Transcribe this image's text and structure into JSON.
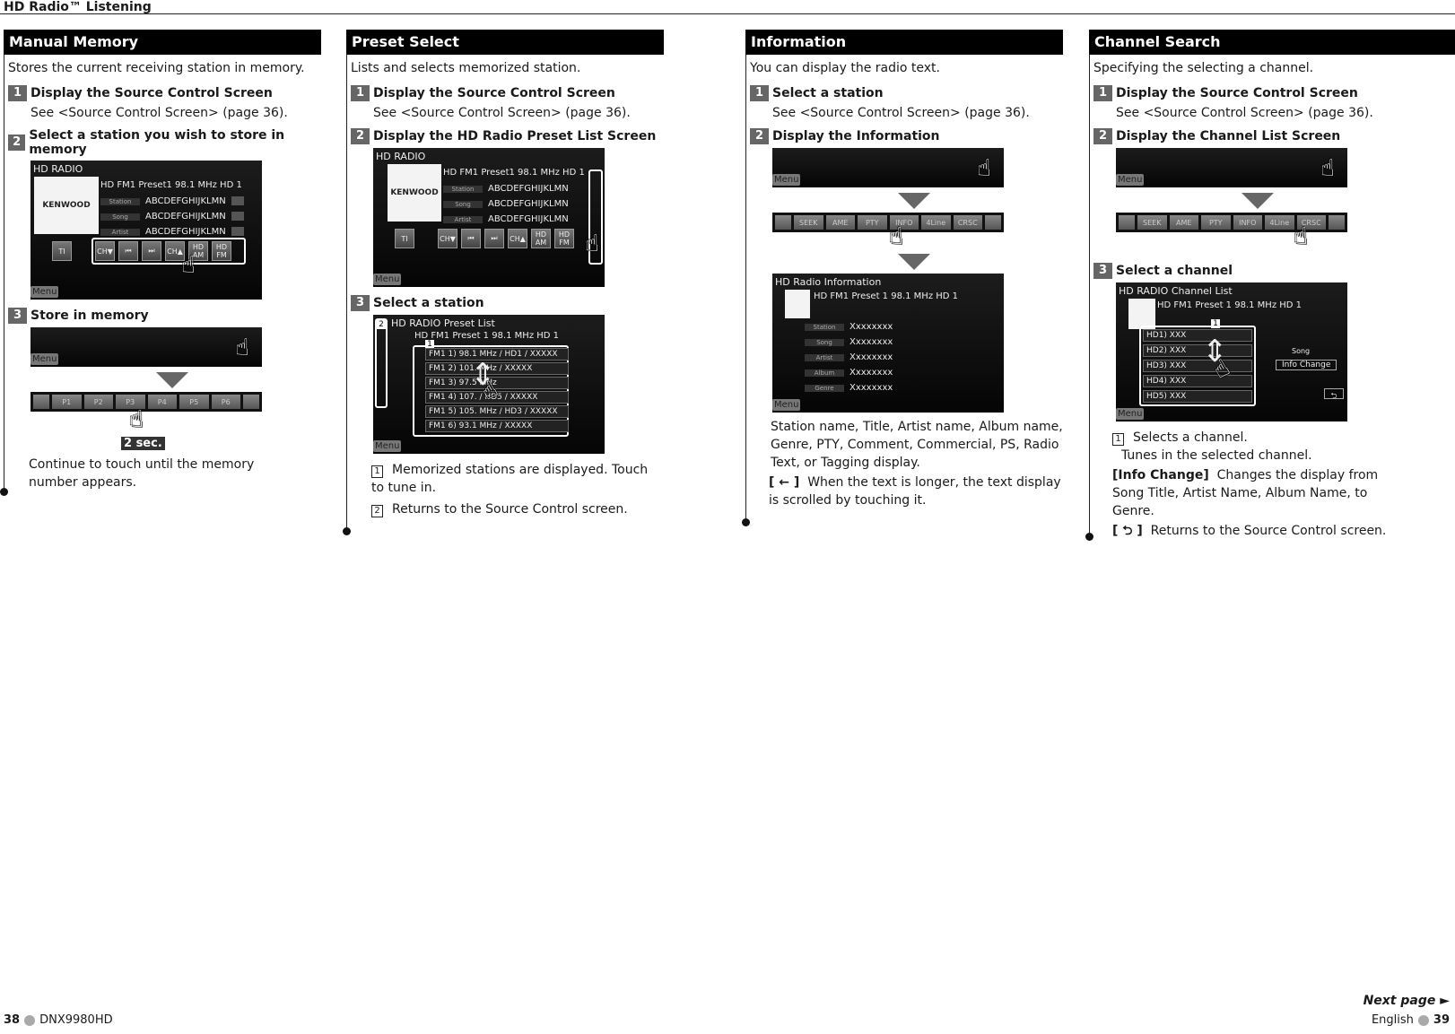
{
  "header": {
    "title": "HD Radio™ Listening"
  },
  "manual_memory": {
    "title": "Manual Memory",
    "intro": "Stores the current receiving station in memory.",
    "steps": [
      {
        "num": "1",
        "label": "Display the Source Control Screen",
        "sub": "See <Source Control Screen> (page 36)."
      },
      {
        "num": "2",
        "label": "Select a station you wish to store in memory"
      },
      {
        "num": "3",
        "label": "Store in memory"
      }
    ],
    "screen": {
      "title": "HD RADIO",
      "logo": "KENWOOD",
      "status": "HD FM1   Preset1   98.1 MHz   HD 1",
      "rows": [
        {
          "label": "Station",
          "value": "ABCDEFGHIJKLMN"
        },
        {
          "label": "Song",
          "value": "ABCDEFGHIJKLMN"
        },
        {
          "label": "Artist",
          "value": "ABCDEFGHIJKLMN"
        }
      ],
      "ti": "TI",
      "controls": [
        "CH▼",
        "⏮",
        "⏭",
        "CH▲",
        "HD AM",
        "HD FM"
      ],
      "menu": "Menu"
    },
    "preset_bar": [
      "",
      "P1",
      "P2",
      "P3",
      "P4",
      "P5",
      "P6",
      ""
    ],
    "hold_badge": "2 sec.",
    "note": "Continue to touch until the memory number appears."
  },
  "preset_select": {
    "title": "Preset Select",
    "intro": "Lists and selects memorized station.",
    "steps": [
      {
        "num": "1",
        "label": "Display the Source Control Screen",
        "sub": "See <Source Control Screen> (page 36)."
      },
      {
        "num": "2",
        "label": "Display the HD Radio Preset List Screen"
      },
      {
        "num": "3",
        "label": "Select a station"
      }
    ],
    "list_screen": {
      "title": "HD RADIO Preset List",
      "status": "HD FM1   Preset 1   98.1 MHz   HD 1",
      "items": [
        "FM1 1) 98.1 MHz / HD1 / XXXXX",
        "FM1 2) 101.  MHz / XXXXX",
        "FM1 3) 97.5  MHz",
        "FM1 4) 107.   / HD5 / XXXXX",
        "FM1 5) 105.  MHz / HD3 / XXXXX",
        "FM1 6) 93.1 MHz / XXXXX"
      ],
      "menu": "Menu"
    },
    "notes": [
      {
        "num": "1",
        "text": "Memorized stations are displayed. Touch to tune in."
      },
      {
        "num": "2",
        "text": "Returns to the Source Control screen."
      }
    ]
  },
  "information": {
    "title": "Information",
    "intro": "You can display the radio text.",
    "steps": [
      {
        "num": "1",
        "label": "Select a station",
        "sub": "See <Source Control Screen> (page 36)."
      },
      {
        "num": "2",
        "label": "Display the Information"
      }
    ],
    "func_bar": [
      "",
      "SEEK",
      "AME",
      "PTY",
      "INFO",
      "4Line",
      "CRSC",
      ""
    ],
    "info_screen": {
      "title": "HD Radio Information",
      "status": "HD FM1   Preset 1   98.1 MHz   HD 1",
      "rows": [
        {
          "label": "Station",
          "value": "Xxxxxxxx"
        },
        {
          "label": "Song",
          "value": "Xxxxxxxx"
        },
        {
          "label": "Artist",
          "value": "Xxxxxxxx"
        },
        {
          "label": "Album",
          "value": "Xxxxxxxx"
        },
        {
          "label": "Genre",
          "value": "Xxxxxxxx"
        }
      ],
      "menu": "Menu"
    },
    "desc": "Station name, Title, Artist name, Album name, Genre, PTY, Comment, Commercial, PS, Radio Text, or Tagging display.",
    "scroll_key": "[ ← ]",
    "scroll_note": "When the text is longer, the text display is scrolled by touching it."
  },
  "channel_search": {
    "title": "Channel Search",
    "intro": "Specifying the selecting a channel.",
    "steps": [
      {
        "num": "1",
        "label": "Display the Source Control Screen",
        "sub": "See <Source Control Screen> (page 36)."
      },
      {
        "num": "2",
        "label": "Display the Channel List Screen"
      },
      {
        "num": "3",
        "label": "Select a channel"
      }
    ],
    "func_bar": [
      "",
      "SEEK",
      "AME",
      "PTY",
      "INFO",
      "4Line",
      "CRSC",
      ""
    ],
    "channel_screen": {
      "title": "HD RADIO Channel List",
      "status": "HD FM1   Preset 1   98.1 MHz   HD 1",
      "items": [
        "HD1) XXX",
        "HD2) XXX",
        "HD3) XXX",
        "HD4) XXX",
        "HD5) XXX"
      ],
      "song_label": "Song",
      "info_change": "Info Change",
      "menu": "Menu"
    },
    "note1_num": "1",
    "note1_a": "Selects a channel.",
    "note1_b": "Tunes in the selected channel.",
    "info_change_key": "[Info Change]",
    "info_change_text": "Changes the display from Song Title, Artist Name, Album Name, to Genre.",
    "return_key": "[ ⮌ ]",
    "return_text": "Returns to the Source Control screen."
  },
  "footer": {
    "left_page": "38",
    "left_model": "DNX9980HD",
    "next_page": "Next page ►",
    "right_lang": "English",
    "right_page": "39"
  }
}
